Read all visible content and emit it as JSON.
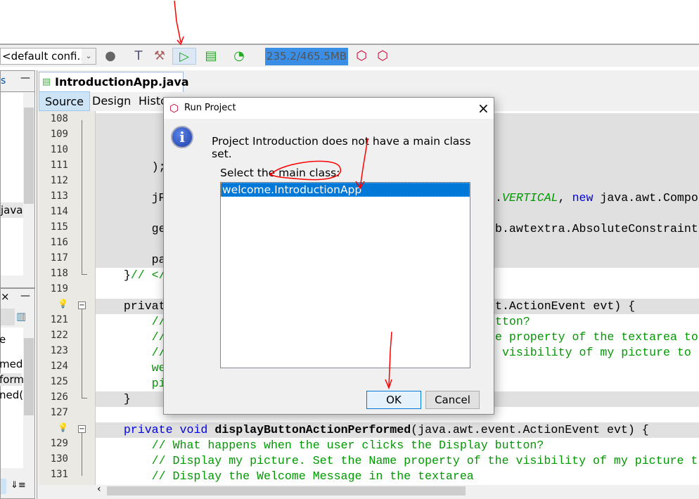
{
  "toolbar": {
    "config_combo": "<default confi...",
    "memory": "235.2/465.5MB",
    "memory_used_fraction": 0.505
  },
  "left_top_panel": {
    "tab_fragment": "s",
    "minimize": "—",
    "items": [
      "java"
    ]
  },
  "left_bottom_panel": {
    "close": "×",
    "minimize": "—",
    "items": [
      "e",
      "med",
      "form",
      "ned("
    ]
  },
  "editor": {
    "file_tab": "IntroductionApp.java",
    "close": "×",
    "tabs": [
      "Source",
      "Design",
      "Histo"
    ],
    "line_numbers": [
      "108",
      "109",
      "110",
      "111",
      "112",
      "113",
      "114",
      "115",
      "116",
      "117",
      "118",
      "119",
      "",
      "121",
      "122",
      "123",
      "124",
      "125",
      "126",
      "127",
      "",
      "129",
      "130",
      "131"
    ],
    "lines": [
      {
        "t": "",
        "g": 1
      },
      {
        "t": "",
        "g": 1
      },
      {
        "t": "",
        "g": 1
      },
      {
        "t": "        );",
        "g": 1
      },
      {
        "t": "",
        "g": 1
      },
      {
        "t": "        jP",
        "r": ".VERTICAL, new java.awt.Compo",
        "g": 1
      },
      {
        "t": "",
        "g": 1
      },
      {
        "t": "        ge",
        "r": "b.awtextra.AbsoluteConstraint",
        "g": 1
      },
      {
        "t": "",
        "g": 1
      },
      {
        "t": "        pa",
        "g": 1
      },
      {
        "t": "    }// </",
        "g": 0
      },
      {
        "t": "",
        "g": 0
      },
      {
        "t": "    privat",
        "r": "t.ActionEvent evt) {",
        "g": 1
      },
      {
        "t": "        //",
        "r": "tton?",
        "g": 0
      },
      {
        "t": "        //",
        "r": "e property of the textarea to",
        "g": 0
      },
      {
        "t": "        //",
        "r": " visibility of my picture to",
        "g": 0
      },
      {
        "t": "        we",
        "g": 0
      },
      {
        "t": "        pi",
        "g": 0
      },
      {
        "t": "    }",
        "g": 1
      },
      {
        "t": "",
        "g": 0
      },
      {
        "t": "    private void displayButtonActionPerformed(java.awt.event.ActionEvent evt) {",
        "g": 1
      },
      {
        "t": "        // What happens when the user clicks the Display button?",
        "g": 0
      },
      {
        "t": "        // Display my picture. Set the Name property of the visibility of my picture t",
        "g": 0
      },
      {
        "t": "        // Display the Welcome Message in the textarea",
        "g": 0
      }
    ]
  },
  "dialog": {
    "title": "Run Project",
    "message": "Project Introduction does not have a main class set.",
    "label": "Select the main class:",
    "classes": [
      "welcome.IntroductionApp"
    ],
    "ok": "OK",
    "cancel": "Cancel",
    "close": "×"
  },
  "colors": {
    "selection": "#0078d7",
    "annotation": "#ff0000"
  }
}
